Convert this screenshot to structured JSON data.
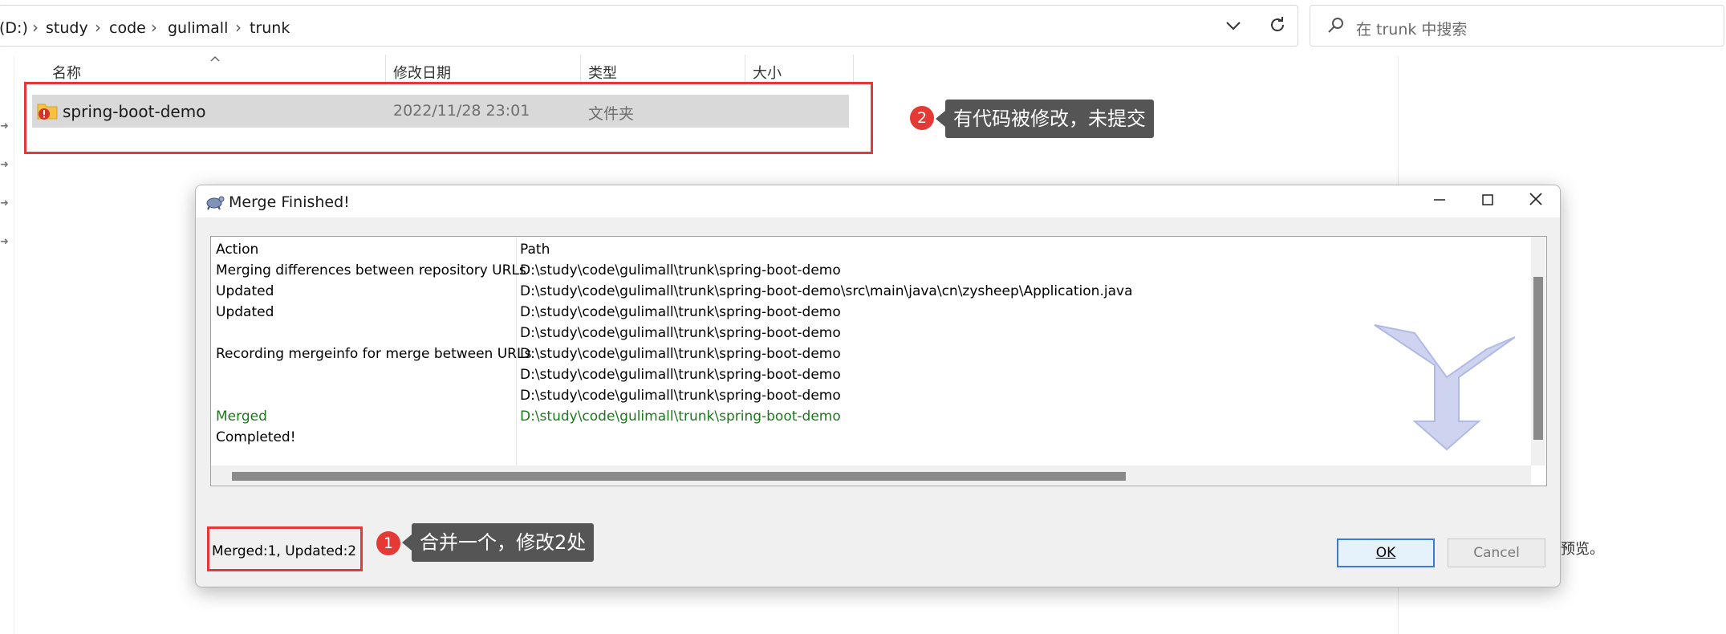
{
  "explorer": {
    "breadcrumbs": [
      "(D:)",
      "study",
      "code",
      "gulimall",
      "trunk"
    ],
    "search_placeholder": "在 trunk 中搜索",
    "columns": {
      "name": "名称",
      "modified": "修改日期",
      "type": "类型",
      "size": "大小"
    },
    "rows": [
      {
        "name": "spring-boot-demo",
        "modified": "2022/11/28 23:01",
        "type": "文件夹",
        "size": ""
      }
    ],
    "right_pane_text": "预览。"
  },
  "annotations": {
    "badge_1": "1",
    "callout_1": "合并一个，修改2处",
    "badge_2": "2",
    "callout_2": "有代码被修改，未提交",
    "colors": {
      "highlight": "#e53935",
      "callout_bg": "#555555"
    }
  },
  "dialog": {
    "title": "Merge Finished!",
    "header": {
      "action": "Action",
      "path": "Path"
    },
    "rows": [
      {
        "action": "Merging differences between repository URLs",
        "path": "D:\\study\\code\\gulimall\\trunk\\spring-boot-demo",
        "color": "black"
      },
      {
        "action": "Updated",
        "path": "D:\\study\\code\\gulimall\\trunk\\spring-boot-demo\\src\\main\\java\\cn\\zysheep\\Application.java",
        "color": "black"
      },
      {
        "action": "Updated",
        "path": "D:\\study\\code\\gulimall\\trunk\\spring-boot-demo",
        "color": "black"
      },
      {
        "action": "",
        "path": "D:\\study\\code\\gulimall\\trunk\\spring-boot-demo",
        "color": "black"
      },
      {
        "action": "Recording mergeinfo for merge between URLs",
        "path": "D:\\study\\code\\gulimall\\trunk\\spring-boot-demo",
        "color": "black"
      },
      {
        "action": "",
        "path": "D:\\study\\code\\gulimall\\trunk\\spring-boot-demo",
        "color": "black"
      },
      {
        "action": "",
        "path": "D:\\study\\code\\gulimall\\trunk\\spring-boot-demo",
        "color": "black"
      },
      {
        "action": "Merged",
        "path": "D:\\study\\code\\gulimall\\trunk\\spring-boot-demo",
        "color": "green"
      },
      {
        "action": "Completed!",
        "path": "",
        "color": "black"
      }
    ],
    "status": "Merged:1, Updated:2",
    "ok_label": "OK",
    "cancel_label": "Cancel",
    "colors": {
      "merged_text": "#1a7a1a",
      "ok_border": "#3b7bd4"
    }
  }
}
